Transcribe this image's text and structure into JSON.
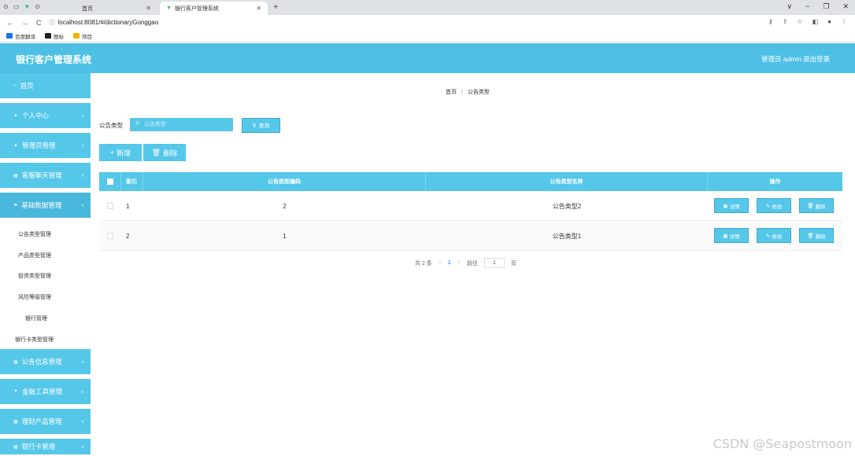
{
  "browser": {
    "tabs": [
      {
        "label": "首页"
      },
      {
        "label": "银行客户管理系统"
      }
    ],
    "url": "localhost:8081/#/dictionaryGonggao",
    "bookmarks": [
      "百度翻译",
      "图标",
      "项目"
    ],
    "colors": {
      "bm1": "#1a73e8",
      "bm2": "#202124",
      "bm3": "#f4b400"
    }
  },
  "header": {
    "title": "银行客户管理系统",
    "user": "管理员 admin",
    "logout": "退出登录",
    "color": "#4ec0e6"
  },
  "sidebar": {
    "items": [
      {
        "label": "首页",
        "icon": "home-icon"
      },
      {
        "label": "个人中心",
        "icon": "user-icon"
      },
      {
        "label": "管理员管理",
        "icon": "user-icon"
      },
      {
        "label": "客服聊天管理",
        "icon": "grid-icon"
      },
      {
        "label": "基础数据管理",
        "icon": "flag-icon"
      },
      {
        "label": "公告信息管理",
        "icon": "grid-icon"
      },
      {
        "label": "金融工具管理",
        "icon": "filter-icon"
      },
      {
        "label": "理财产品管理",
        "icon": "grid-icon"
      },
      {
        "label": "银行卡管理",
        "icon": "grid-icon"
      }
    ],
    "sub_items": [
      "公告类型管理",
      "产品类型管理",
      "投资类型管理",
      "风险等级管理",
      "银行管理",
      "银行卡类型管理"
    ]
  },
  "breadcrumb": {
    "home": "首页",
    "sep": "/",
    "current": "公告类型"
  },
  "search": {
    "label": "公告类型",
    "placeholder": "公告类型",
    "button": "查询"
  },
  "toolbar": {
    "add": "新增",
    "delete": "删除"
  },
  "table": {
    "headers": {
      "index": "索引",
      "code": "公告类型编码",
      "name": "公告类型名称",
      "ops": "操作"
    },
    "rows": [
      {
        "index": "1",
        "code": "2",
        "name": "公告类型2"
      },
      {
        "index": "2",
        "code": "1",
        "name": "公告类型1"
      }
    ],
    "ops": {
      "detail": "详情",
      "edit": "修改",
      "delete": "删除"
    }
  },
  "pager": {
    "total": "共 2 条",
    "page": "1",
    "goto": "前往",
    "goto_value": "1",
    "unit": "页"
  },
  "watermark": "CSDN @Seapostmoon"
}
